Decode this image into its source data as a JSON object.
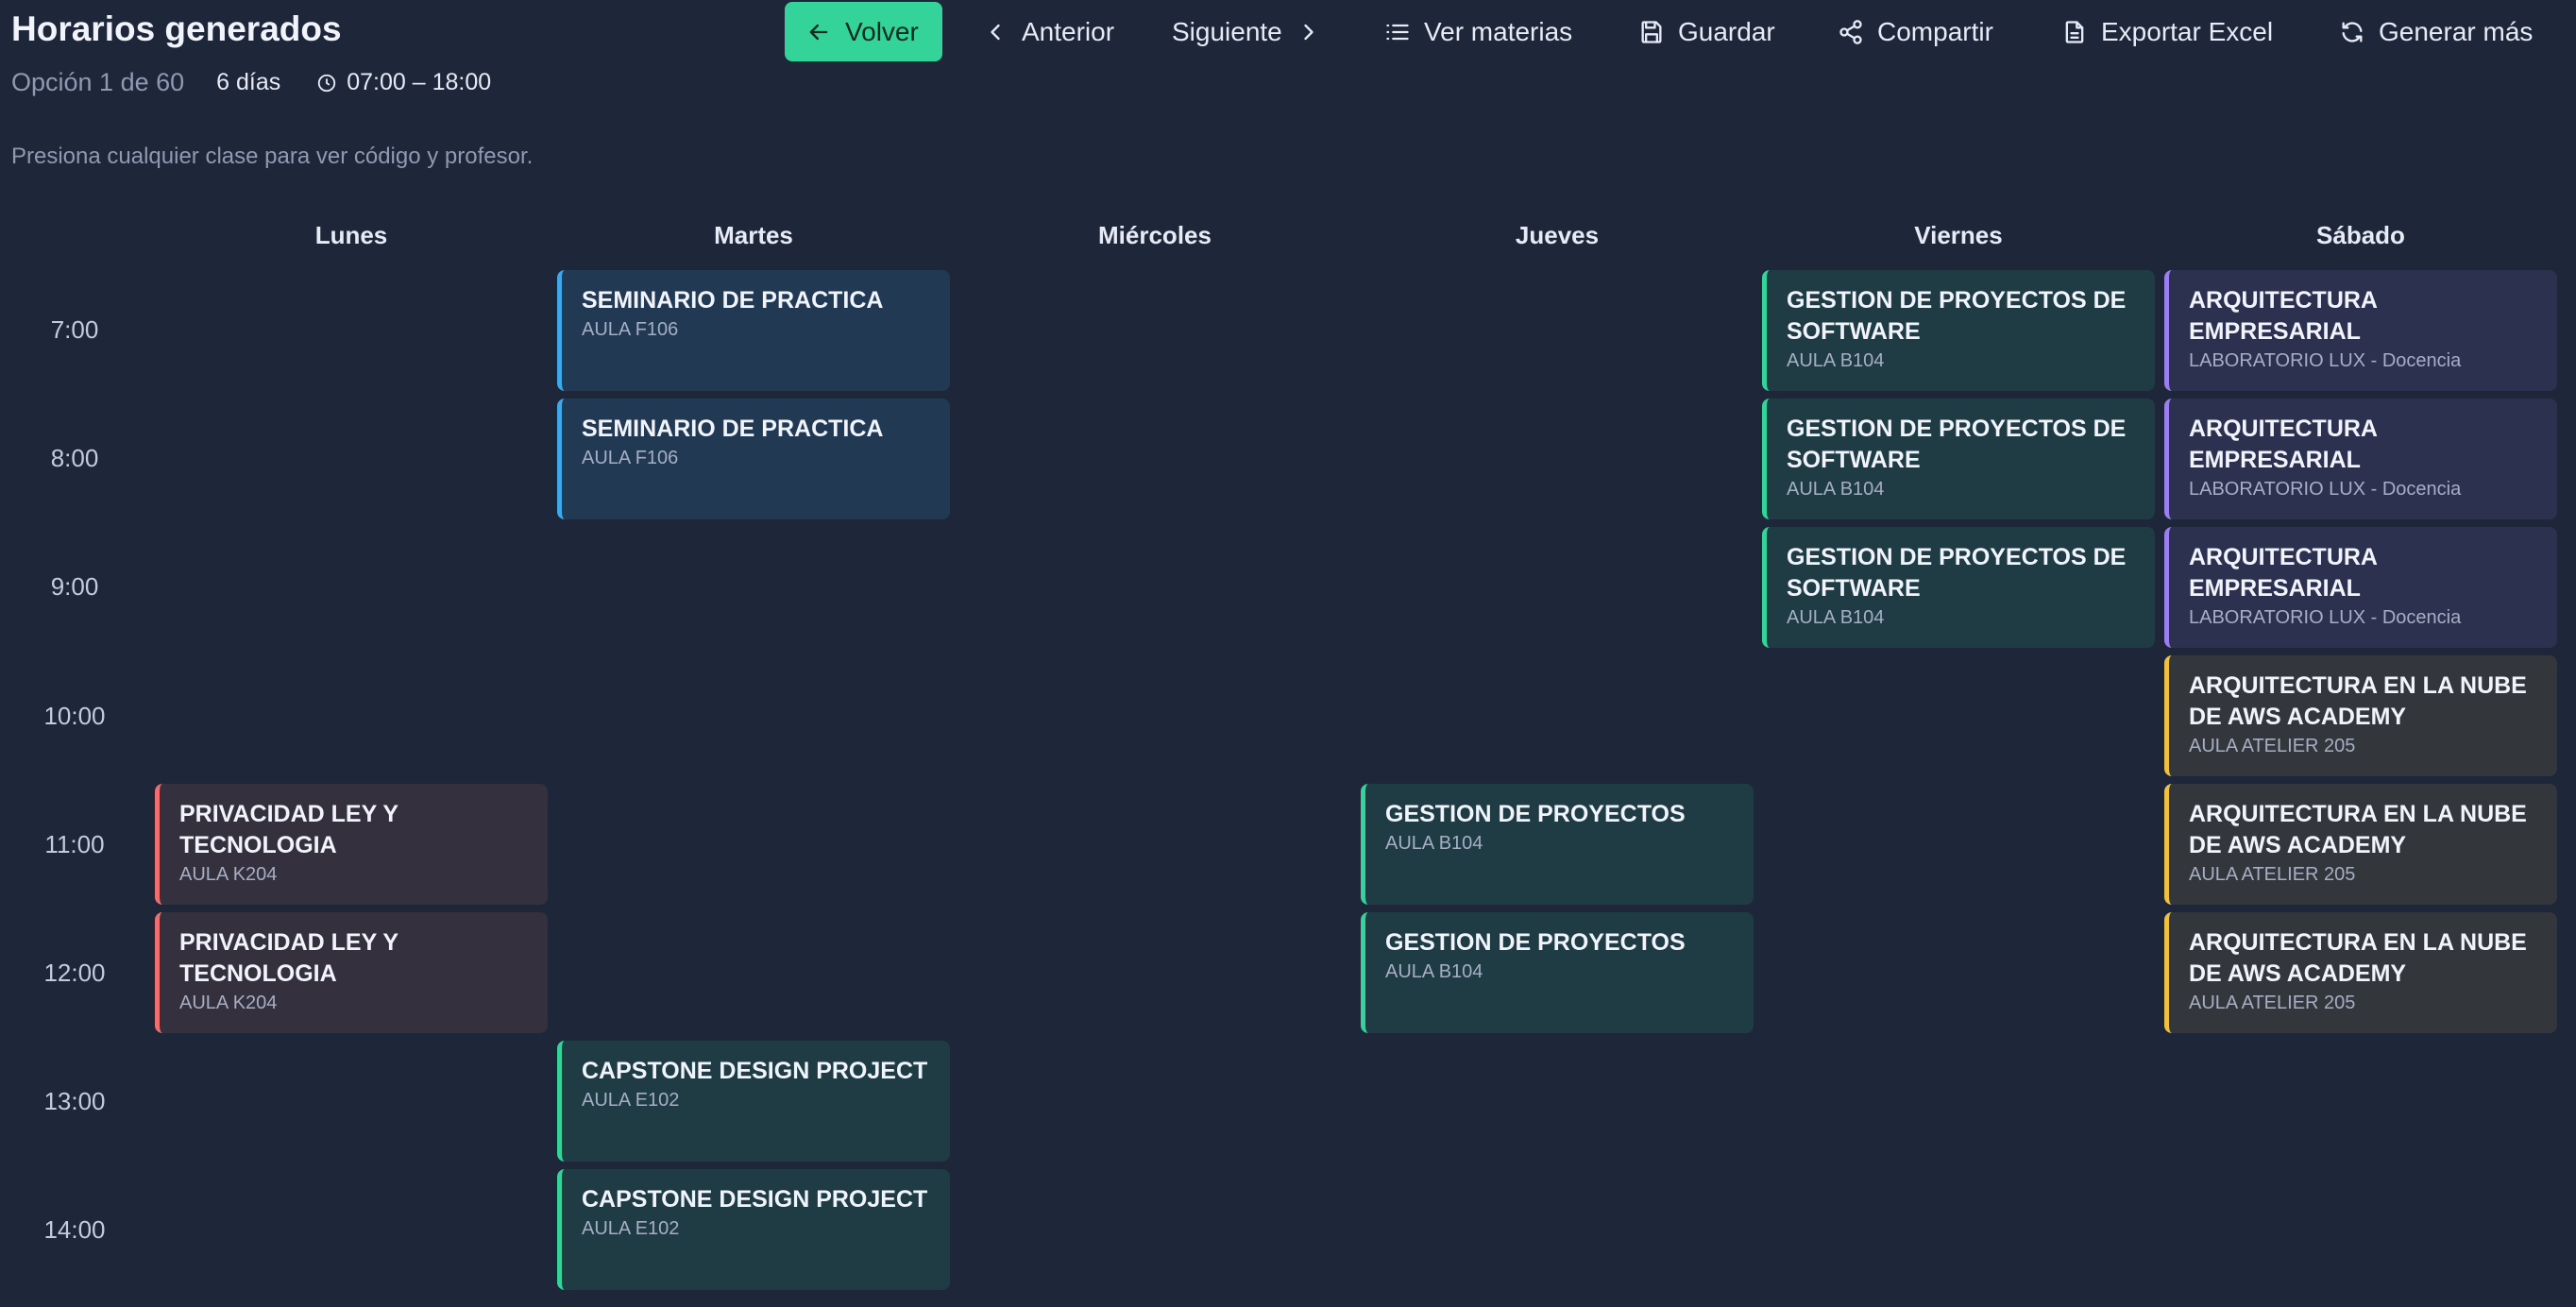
{
  "header": {
    "title": "Horarios generados",
    "option": "Opción 1 de 60",
    "days": "6 días",
    "hours": "07:00 – 18:00",
    "hint": "Presiona cualquier clase para ver código y profesor."
  },
  "toolbar": {
    "volver": "Volver",
    "anterior": "Anterior",
    "siguiente": "Siguiente",
    "ver_materias": "Ver materias",
    "guardar": "Guardar",
    "compartir": "Compartir",
    "exportar": "Exportar Excel",
    "generar": "Generar más"
  },
  "days": [
    "Lunes",
    "Martes",
    "Miércoles",
    "Jueves",
    "Viernes",
    "Sábado"
  ],
  "times": [
    "7:00",
    "8:00",
    "9:00",
    "10:00",
    "11:00",
    "12:00",
    "13:00",
    "14:00"
  ],
  "classes": [
    {
      "name": "SEMINARIO DE PRACTICA",
      "room": "AULA F106",
      "day": 1,
      "slot": 0,
      "color": "#3ea8e8"
    },
    {
      "name": "SEMINARIO DE PRACTICA",
      "room": "AULA F106",
      "day": 1,
      "slot": 1,
      "color": "#3ea8e8"
    },
    {
      "name": "GESTION DE PROYECTOS DE SOFTWARE",
      "room": "AULA B104",
      "day": 4,
      "slot": 0,
      "color": "#34d399"
    },
    {
      "name": "GESTION DE PROYECTOS DE SOFTWARE",
      "room": "AULA B104",
      "day": 4,
      "slot": 1,
      "color": "#34d399"
    },
    {
      "name": "GESTION DE PROYECTOS DE SOFTWARE",
      "room": "AULA B104",
      "day": 4,
      "slot": 2,
      "color": "#34d399"
    },
    {
      "name": "ARQUITECTURA EMPRESARIAL",
      "room": "LABORATORIO LUX - Docencia",
      "day": 5,
      "slot": 0,
      "color": "#9b7ff0"
    },
    {
      "name": "ARQUITECTURA EMPRESARIAL",
      "room": "LABORATORIO LUX - Docencia",
      "day": 5,
      "slot": 1,
      "color": "#9b7ff0"
    },
    {
      "name": "ARQUITECTURA EMPRESARIAL",
      "room": "LABORATORIO LUX - Docencia",
      "day": 5,
      "slot": 2,
      "color": "#9b7ff0"
    },
    {
      "name": "ARQUITECTURA EN LA NUBE DE AWS ACADEMY",
      "room": "AULA ATELIER 205",
      "day": 5,
      "slot": 3,
      "color": "#f0c040"
    },
    {
      "name": "ARQUITECTURA EN LA NUBE DE AWS ACADEMY",
      "room": "AULA ATELIER 205",
      "day": 5,
      "slot": 4,
      "color": "#f0c040"
    },
    {
      "name": "ARQUITECTURA EN LA NUBE DE AWS ACADEMY",
      "room": "AULA ATELIER 205",
      "day": 5,
      "slot": 5,
      "color": "#f0c040"
    },
    {
      "name": "PRIVACIDAD LEY Y TECNOLOGIA",
      "room": "AULA K204",
      "day": 0,
      "slot": 4,
      "color": "#ef6f70"
    },
    {
      "name": "PRIVACIDAD LEY Y TECNOLOGIA",
      "room": "AULA K204",
      "day": 0,
      "slot": 5,
      "color": "#ef6f70"
    },
    {
      "name": "GESTION DE PROYECTOS",
      "room": "AULA B104",
      "day": 3,
      "slot": 4,
      "color": "#34d399"
    },
    {
      "name": "GESTION DE PROYECTOS",
      "room": "AULA B104",
      "day": 3,
      "slot": 5,
      "color": "#34d399"
    },
    {
      "name": "CAPSTONE DESIGN PROJECT",
      "room": "AULA E102",
      "day": 1,
      "slot": 6,
      "color": "#34d399"
    },
    {
      "name": "CAPSTONE DESIGN PROJECT",
      "room": "AULA E102",
      "day": 1,
      "slot": 7,
      "color": "#34d399"
    }
  ]
}
